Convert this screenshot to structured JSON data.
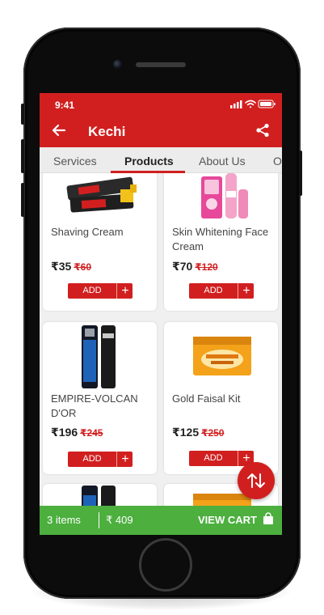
{
  "status_bar": {
    "time": "9:41"
  },
  "app_bar": {
    "title": "Kechi"
  },
  "tabs": [
    {
      "label": "Services",
      "active": false
    },
    {
      "label": "Products",
      "active": true
    },
    {
      "label": "About Us",
      "active": false
    },
    {
      "label": "O",
      "active": false
    }
  ],
  "products": [
    {
      "name": "Shaving Cream",
      "price": "₹35",
      "mrp": "₹60",
      "add_label": "ADD",
      "image": "shaving-cream-tubes"
    },
    {
      "name": "Skin Whitening Face Cream",
      "price": "₹70",
      "mrp": "₹120",
      "add_label": "ADD",
      "image": "face-cream-pink-pack"
    },
    {
      "name": "EMPIRE-VOLCAN D'OR",
      "price": "₹196",
      "mrp": "₹245",
      "add_label": "ADD",
      "image": "deodorant-cans"
    },
    {
      "name": "Gold Faisal Kit",
      "price": "₹125",
      "mrp": "₹250",
      "add_label": "ADD",
      "image": "gold-facial-kit-box"
    }
  ],
  "cart": {
    "items": "3 items",
    "total": "₹ 409",
    "action": "VIEW CART"
  },
  "colors": {
    "primary": "#d11f1f",
    "cart_bar": "#4caf3e",
    "phone_body": "#0c0c0c"
  }
}
